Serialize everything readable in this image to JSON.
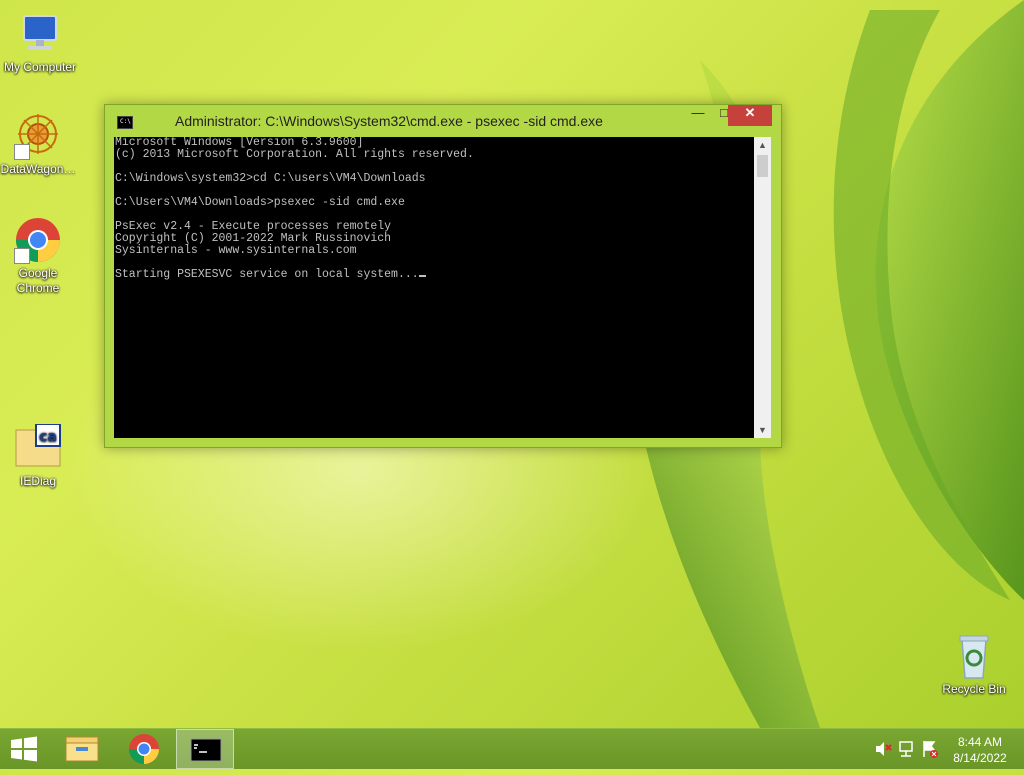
{
  "desktop": {
    "icons": [
      {
        "label": "My Computer"
      },
      {
        "label": "DataWagon…"
      },
      {
        "label": "Google Chrome"
      },
      {
        "label": "IEDiag"
      },
      {
        "label": "Recycle Bin"
      }
    ]
  },
  "window": {
    "title": "Administrator: C:\\Windows\\System32\\cmd.exe - psexec  -sid cmd.exe",
    "icon_text": "C:\\",
    "minimize": "—",
    "maximize": "□",
    "close": "✕",
    "console_lines": [
      "Microsoft Windows [Version 6.3.9600]",
      "(c) 2013 Microsoft Corporation. All rights reserved.",
      "",
      "C:\\Windows\\system32>cd C:\\users\\VM4\\Downloads",
      "",
      "C:\\Users\\VM4\\Downloads>psexec -sid cmd.exe",
      "",
      "PsExec v2.4 - Execute processes remotely",
      "Copyright (C) 2001-2022 Mark Russinovich",
      "Sysinternals - www.sysinternals.com",
      "",
      "Starting PSEXESVC service on local system..."
    ]
  },
  "taskbar": {
    "items": [
      {
        "name": "start-button"
      },
      {
        "name": "file-explorer"
      },
      {
        "name": "google-chrome"
      },
      {
        "name": "command-prompt"
      }
    ],
    "clock": {
      "time": "8:44 AM",
      "date": "8/14/2022"
    }
  },
  "colors": {
    "accent": "#b3d845",
    "close": "#c7413c",
    "taskbar": "#6f9a2c"
  }
}
